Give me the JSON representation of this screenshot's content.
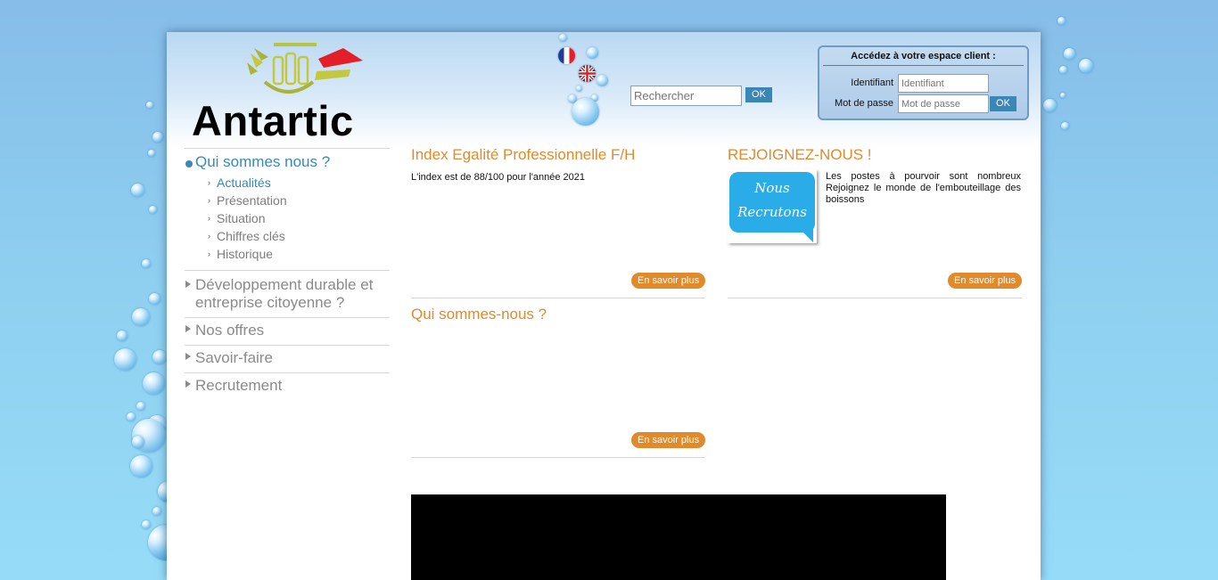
{
  "header": {
    "logo_text": "Antartic",
    "languages": [
      {
        "code": "fr",
        "label": "Français"
      },
      {
        "code": "en",
        "label": "English"
      }
    ],
    "search": {
      "placeholder": "Rechercher",
      "button_label": "OK"
    },
    "login": {
      "title": "Accédez à votre espace client :",
      "username_label": "Identifiant",
      "username_placeholder": "Identifiant",
      "password_label": "Mot de passe",
      "password_placeholder": "Mot de passe",
      "button_label": "OK"
    }
  },
  "sidebar": {
    "main_item": "Qui sommes nous ?",
    "sub_items": [
      "Actualités",
      "Présentation",
      "Situation",
      "Chiffres clés",
      "Historique"
    ],
    "sections": [
      "Développement durable et entreprise citoyenne ?",
      "Nos offres",
      "Savoir-faire",
      "Recrutement"
    ]
  },
  "content": {
    "index_block": {
      "title": "Index Egalité Professionnelle F/H",
      "text": "L'index est de 88/100 pour l'année 2021",
      "button_label": "En savoir plus"
    },
    "recruit_block": {
      "title": "REJOIGNEZ-NOUS !",
      "image_line1": "Nous",
      "image_line2": "Recrutons",
      "text": "Les postes à pourvoir sont nombreux Rejoignez le monde de l'embouteillage des boissons",
      "button_label": "En savoir plus"
    },
    "about_block": {
      "title": "Qui sommes-nous ?",
      "button_label": "En savoir plus"
    }
  },
  "colors": {
    "accent_orange": "#e08a2c",
    "accent_blue": "#3a87b8",
    "recruit_blue": "#2aace8"
  }
}
